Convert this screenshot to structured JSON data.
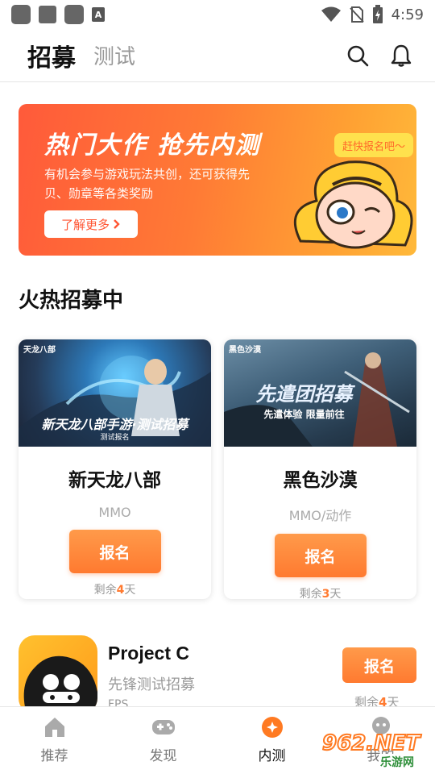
{
  "status_bar": {
    "time": "4:59",
    "notif_letter": "A"
  },
  "header": {
    "tabs": [
      {
        "label": "招募",
        "active": true
      },
      {
        "label": "测试",
        "active": false
      }
    ],
    "icons": [
      "search-icon",
      "bell-icon"
    ]
  },
  "banner": {
    "title": "热门大作 抢先内测",
    "description": "有机会参与游戏玩法共创，还可获得先贝、勋章等各类奖励",
    "button_label": "了解更多",
    "bubble_text": "赶快报名吧～"
  },
  "section_title": "火热招募中",
  "cards": [
    {
      "image_caption": "新天龙八部手游·测试招募",
      "image_sub": "测试报名",
      "image_logo": "天龙八部",
      "name": "新天龙八部",
      "genre": "MMO",
      "button_label": "报名",
      "remaining_prefix": "剩余",
      "remaining_days": "4",
      "remaining_suffix": "天"
    },
    {
      "image_caption": "先遣团招募",
      "image_sub": "先遣体验 限量前往",
      "image_logo": "黑色沙漠",
      "name": "黑色沙漠",
      "genre": "MMO/动作",
      "button_label": "报名",
      "remaining_prefix": "剩余",
      "remaining_days": "3",
      "remaining_suffix": "天"
    }
  ],
  "list_item": {
    "title": "Project C",
    "subtitle": "先锋测试招募",
    "genre": "FPS",
    "button_label": "报名",
    "remaining_prefix": "剩余",
    "remaining_days": "4",
    "remaining_suffix": "天"
  },
  "bottom_nav": [
    {
      "label": "推荐",
      "icon": "home-icon",
      "active": false
    },
    {
      "label": "发现",
      "icon": "gamepad-icon",
      "active": false
    },
    {
      "label": "内测",
      "icon": "beta-icon",
      "active": true
    },
    {
      "label": "我的",
      "icon": "profile-icon",
      "active": false
    }
  ],
  "watermark": {
    "top": "962.NET",
    "bottom": "乐游网"
  },
  "colors": {
    "accent": "#ff7a30",
    "banner_start": "#ff5a3a",
    "banner_end": "#ffb93a"
  }
}
